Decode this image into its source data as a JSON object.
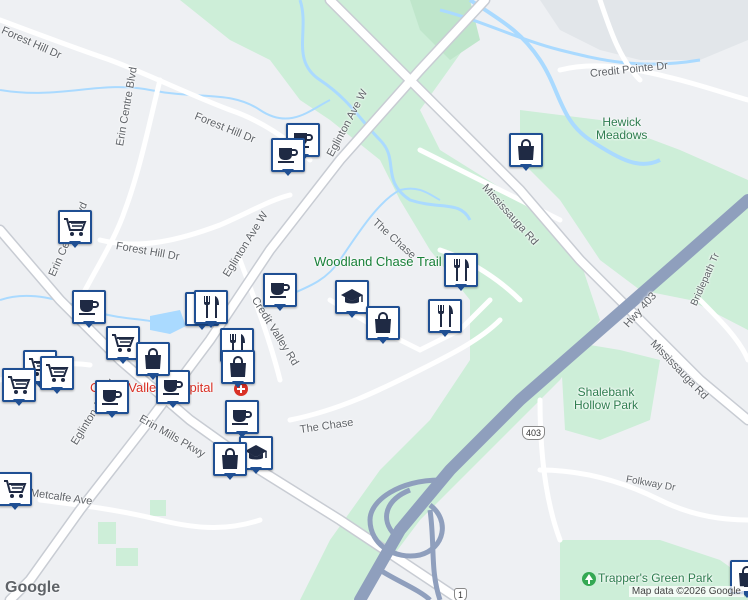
{
  "map": {
    "streets": [
      {
        "id": "forest-hill-dr-1",
        "text": "Forest Hill Dr"
      },
      {
        "id": "forest-hill-dr-2",
        "text": "Forest Hill Dr"
      },
      {
        "id": "forest-hill-dr-3",
        "text": "Forest Hill Dr"
      },
      {
        "id": "erin-centre-blvd-1",
        "text": "Erin Centre Blvd"
      },
      {
        "id": "erin-centre-blvd-2",
        "text": "Erin Centre Blvd"
      },
      {
        "id": "eglinton-ave-w-1",
        "text": "Eglinton Ave W"
      },
      {
        "id": "eglinton-ave-w-2",
        "text": "Eglinton Ave W"
      },
      {
        "id": "eglinton-ave-w-3",
        "text": "Eglinton Ave W"
      },
      {
        "id": "credit-valley-rd",
        "text": "Credit Valley Rd"
      },
      {
        "id": "erin-mills-pkwy",
        "text": "Erin Mills Pkwy"
      },
      {
        "id": "metcalfe-ave",
        "text": "Metcalfe Ave"
      },
      {
        "id": "the-chase",
        "text": "The Chase"
      },
      {
        "id": "the-chase-2",
        "text": "The Chase"
      },
      {
        "id": "mississauga-rd-1",
        "text": "Mississauga Rd"
      },
      {
        "id": "mississauga-rd-2",
        "text": "Mississauga Rd"
      },
      {
        "id": "credit-pointe-dr",
        "text": "Credit Pointe Dr"
      },
      {
        "id": "hwy-403",
        "text": "Hwy 403"
      },
      {
        "id": "bridlepath-trail",
        "text": "Bridlepath Tr"
      },
      {
        "id": "folkway-dr",
        "text": "Folkway Dr"
      },
      {
        "id": "ramp",
        "text": "1"
      }
    ],
    "places": [
      {
        "id": "hewick-meadows",
        "text": "Hewick\nMeadows"
      },
      {
        "id": "shalebank-hollow-park",
        "text": "Shalebank\nHollow Park"
      },
      {
        "id": "woodland-chase-trail",
        "text": "Woodland Chase Trail"
      },
      {
        "id": "credit-valley-hospital",
        "text": "Credit Valley Hospital"
      },
      {
        "id": "trappers-green-park",
        "text": "Trapper's Green Park"
      }
    ],
    "highway_shield": "403",
    "logo": "Google",
    "attribution": "Map data ©2026 Google"
  },
  "pins": [
    {
      "type": "cafe"
    },
    {
      "type": "cafe"
    },
    {
      "type": "grocery"
    },
    {
      "type": "bag"
    },
    {
      "type": "restaurant"
    },
    {
      "type": "restaurant"
    },
    {
      "type": "school"
    },
    {
      "type": "bag"
    },
    {
      "type": "cafe"
    },
    {
      "type": "cafe"
    },
    {
      "type": "restaurant"
    },
    {
      "type": "restaurant"
    },
    {
      "type": "grocery"
    },
    {
      "type": "restaurant"
    },
    {
      "type": "grocery"
    },
    {
      "type": "grocery"
    },
    {
      "type": "grocery"
    },
    {
      "type": "cafe"
    },
    {
      "type": "cafe"
    },
    {
      "type": "bag"
    },
    {
      "type": "bag"
    },
    {
      "type": "cafe"
    },
    {
      "type": "school"
    },
    {
      "type": "bag"
    },
    {
      "type": "grocery"
    },
    {
      "type": "bag"
    }
  ],
  "colors": {
    "pin_border": "#1f4f93",
    "park": "#cdeed8",
    "water": "#aadaff",
    "highway": "#8f9fbd",
    "road": "#ffffff"
  }
}
